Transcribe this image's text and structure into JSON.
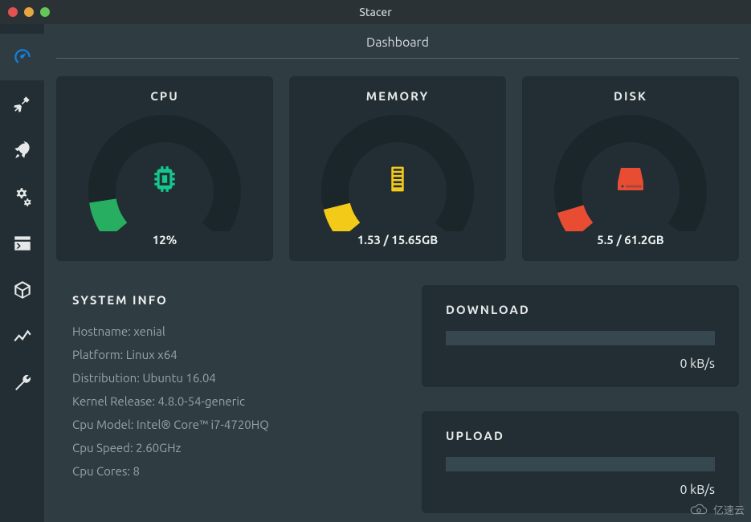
{
  "window": {
    "title": "Stacer"
  },
  "header": {
    "title": "Dashboard"
  },
  "sidebar": {
    "icons": [
      "dashboard-icon",
      "cleaner-icon",
      "startup-icon",
      "services-icon",
      "processes-icon",
      "packages-icon",
      "resources-icon",
      "settings-icon"
    ]
  },
  "gauges": {
    "cpu": {
      "title": "CPU",
      "value": "12%",
      "percent": 12,
      "color": "#27ae60",
      "icon": "cpu-icon"
    },
    "memory": {
      "title": "MEMORY",
      "value": "1.53 / 15.65GB",
      "percent": 10,
      "color": "#f4ca18",
      "icon": "memory-icon"
    },
    "disk": {
      "title": "DISK",
      "value": "5.5 / 61.2GB",
      "percent": 9,
      "color": "#e84d34",
      "icon": "disk-icon"
    }
  },
  "system_info": {
    "title": "SYSTEM INFO",
    "rows": [
      "Hostname: xenial",
      "Platform: Linux x64",
      "Distribution: Ubuntu 16.04",
      "Kernel Release: 4.8.0-54-generic",
      "Cpu Model: Intel® Core™ i7-4720HQ",
      "Cpu Speed: 2.60GHz",
      "Cpu Cores: 8"
    ]
  },
  "network": {
    "download": {
      "title": "DOWNLOAD",
      "rate": "0 kB/s",
      "percent": 0
    },
    "upload": {
      "title": "UPLOAD",
      "rate": "0 kB/s",
      "percent": 0
    }
  },
  "watermark": "亿速云"
}
